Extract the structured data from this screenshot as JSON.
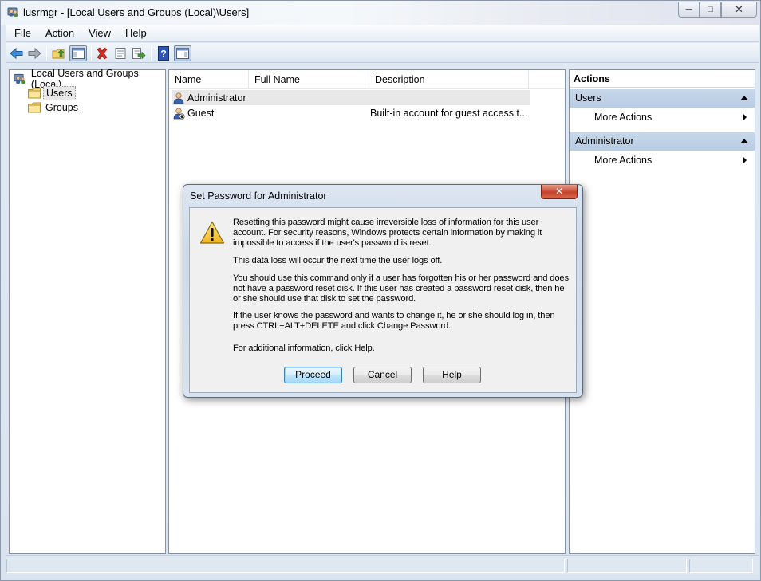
{
  "window": {
    "title": "lusrmgr - [Local Users and Groups (Local)\\Users]",
    "controls": {
      "minimize": "─",
      "maximize": "□",
      "close": "✕"
    }
  },
  "menu": [
    "File",
    "Action",
    "View",
    "Help"
  ],
  "toolbar": {
    "buttons": [
      "back-arrow-icon",
      "forward-arrow-icon",
      "up-folder-icon",
      "show-hide-console-tree-icon",
      "delete-icon",
      "properties-icon",
      "export-list-icon",
      "help-icon",
      "show-hide-action-pane-icon"
    ]
  },
  "tree": {
    "root": "Local Users and Groups (Local)",
    "items": [
      {
        "label": "Users",
        "selected": true
      },
      {
        "label": "Groups",
        "selected": false
      }
    ]
  },
  "list": {
    "columns": [
      "Name",
      "Full Name",
      "Description"
    ],
    "rows": [
      {
        "name": "Administrator",
        "full_name": "",
        "description": ""
      },
      {
        "name": "Guest",
        "full_name": "",
        "description": "Built-in account for guest access t..."
      }
    ]
  },
  "actions": {
    "title": "Actions",
    "groups": [
      {
        "label": "Users",
        "items": [
          "More Actions"
        ]
      },
      {
        "label": "Administrator",
        "items": [
          "More Actions"
        ]
      }
    ]
  },
  "dialog": {
    "title": "Set Password for Administrator",
    "close": "✕",
    "paragraphs": [
      "Resetting this password might cause irreversible loss of information for this user account. For security reasons, Windows protects certain information by making it impossible to access if the user's password is reset.",
      "This data loss will occur the next time the user logs off.",
      "You should use this command only if a user has forgotten his or her password and does not have a password reset disk. If this user has created a password reset disk, then he or she should use that disk to set the password.",
      "If the user knows the password and wants to change it, he or she should log in, then press CTRL+ALT+DELETE and click Change Password.",
      "For additional information, click Help."
    ],
    "buttons": {
      "proceed": "Proceed",
      "cancel": "Cancel",
      "help": "Help"
    }
  },
  "colors": {
    "frame": "#dae4f0",
    "action_group_header": "#c3d3e8",
    "dialog_close": "#c7412b",
    "warning_yellow": "#f7d443"
  }
}
